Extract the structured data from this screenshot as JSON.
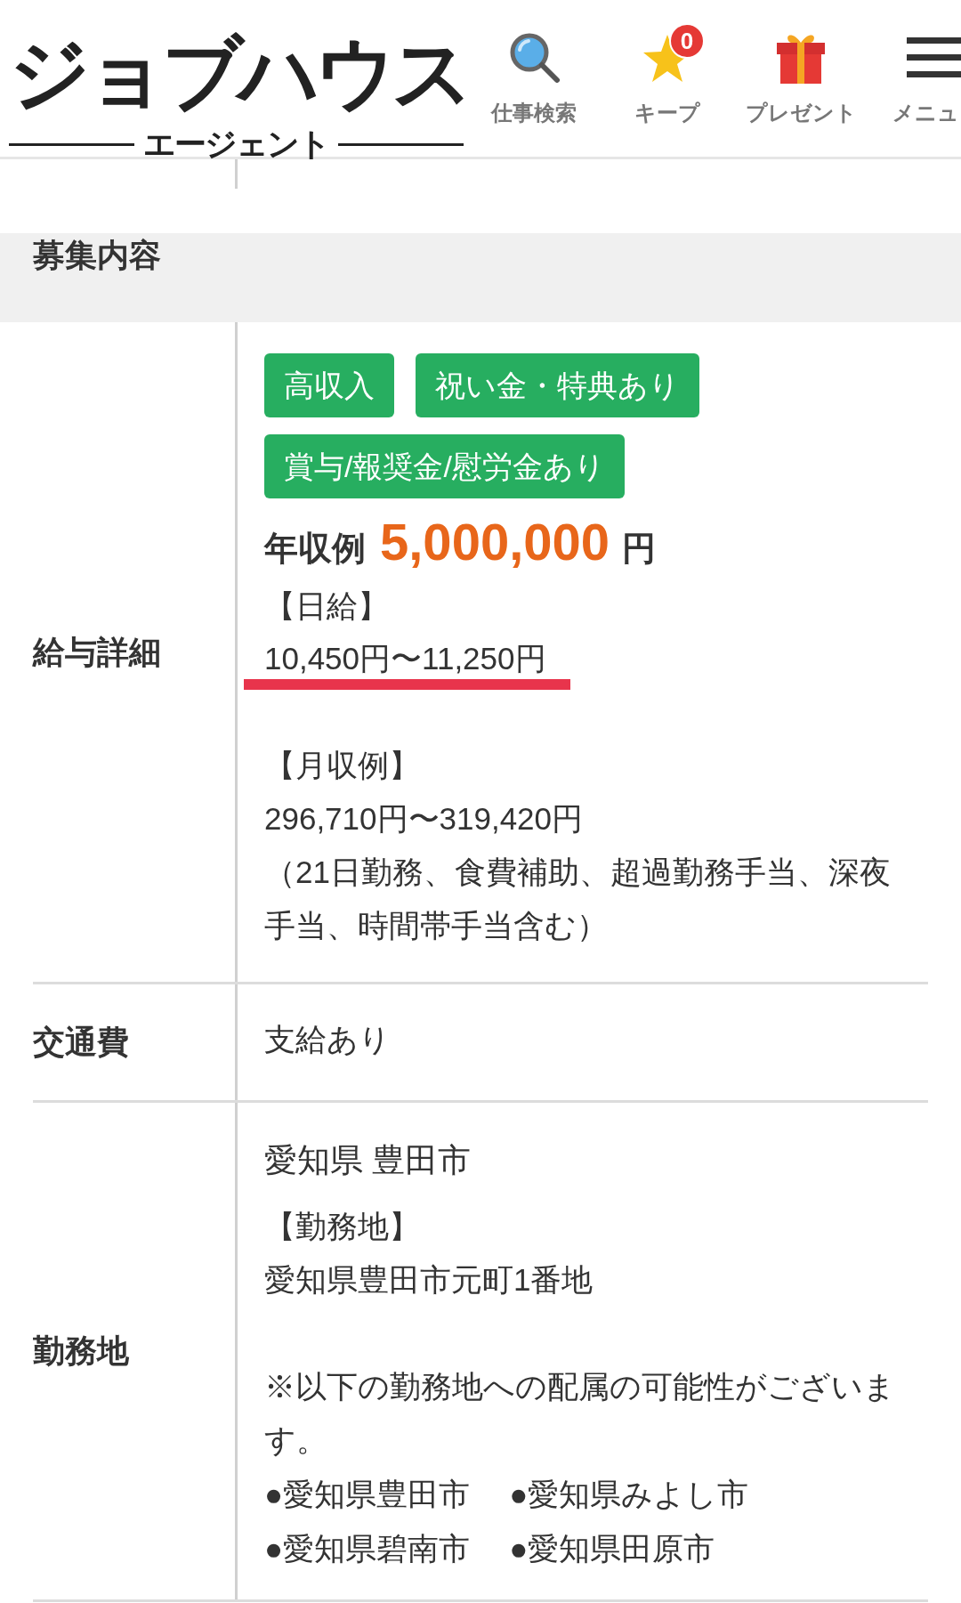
{
  "header": {
    "logo": {
      "title": "ジョブハウス",
      "subtitle": "エージェント"
    },
    "nav": [
      {
        "kind": "search",
        "label": "仕事検索"
      },
      {
        "kind": "keep",
        "label": "キープ",
        "badge": "0"
      },
      {
        "kind": "present",
        "label": "プレゼント"
      },
      {
        "kind": "menu",
        "label": "メニュ"
      }
    ]
  },
  "section": {
    "title": "募集内容"
  },
  "rows": [
    {
      "kind": "salary",
      "label": "給与詳細",
      "tags": [
        "高収入",
        "祝い金・特典あり",
        "賞与/報奨金/慰労金あり"
      ],
      "annual": {
        "label": "年収例",
        "amount": "5,000,000",
        "unit": "円"
      },
      "daily": {
        "heading": "【日給】",
        "value": "10,450円〜11,250円",
        "underlined": true
      },
      "monthly": {
        "heading": "【月収例】",
        "value": "296,710円〜319,420円",
        "note": "（21日勤務、食費補助、超過勤務手当、深夜手当、時間帯手当含む）"
      }
    },
    {
      "kind": "transport",
      "label": "交通費",
      "value": "支給あり"
    },
    {
      "kind": "location",
      "label": "勤務地",
      "area": "愛知県 豊田市",
      "heading": "【勤務地】",
      "address": "愛知県豊田市元町1番地",
      "note": "※以下の勤務地への配属の可能性がございます。",
      "branches": [
        "●愛知県豊田市",
        "●愛知県みよし市",
        "●愛知県碧南市",
        "●愛知県田原市"
      ]
    }
  ]
}
